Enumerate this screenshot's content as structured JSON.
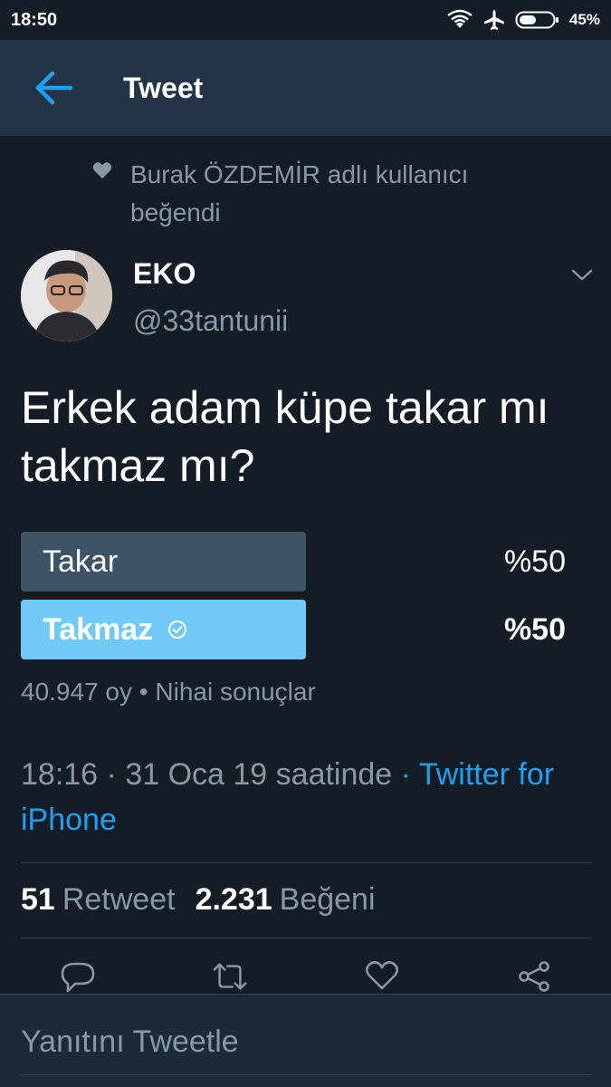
{
  "status_bar": {
    "time": "18:50",
    "battery_percent": "45%",
    "icons": [
      "wifi-icon",
      "airplane-icon",
      "battery-icon"
    ]
  },
  "header": {
    "title": "Tweet",
    "back_icon": "arrow-left-icon"
  },
  "social_context": {
    "icon": "heart-icon",
    "text": "Burak ÖZDEMİR adlı kullanıcı beğendi"
  },
  "author": {
    "name": "EKO",
    "handle": "@33tantunii"
  },
  "tweet": {
    "text": "Erkek adam küpe takar mı takmaz mı?"
  },
  "poll": {
    "options": [
      {
        "label": "Takar",
        "percent": "%50",
        "share": 0.5,
        "winner": false
      },
      {
        "label": "Takmaz",
        "percent": "%50",
        "share": 0.5,
        "winner": true
      }
    ],
    "votes": "40.947 oy",
    "status": "Nihai sonuçlar",
    "separator": "•"
  },
  "meta": {
    "time": "18:16",
    "date": "31 Oca 19 saatinde",
    "separator": "·",
    "source": "Twitter for iPhone"
  },
  "stats": {
    "retweets_count": "51",
    "retweets_label": "Retweet",
    "likes_count": "2.231",
    "likes_label": "Beğeni"
  },
  "actions": [
    "reply-icon",
    "retweet-icon",
    "like-icon",
    "share-icon"
  ],
  "reply": {
    "placeholder": "Yanıtını Tweetle"
  },
  "colors": {
    "background": "#141d26",
    "header": "#243447",
    "accent": "#1da1f2",
    "muted_text": "#8899a6",
    "poll_bar": "#3d5466",
    "poll_bar_winner": "#71c9f8",
    "divider": "#38444d"
  }
}
